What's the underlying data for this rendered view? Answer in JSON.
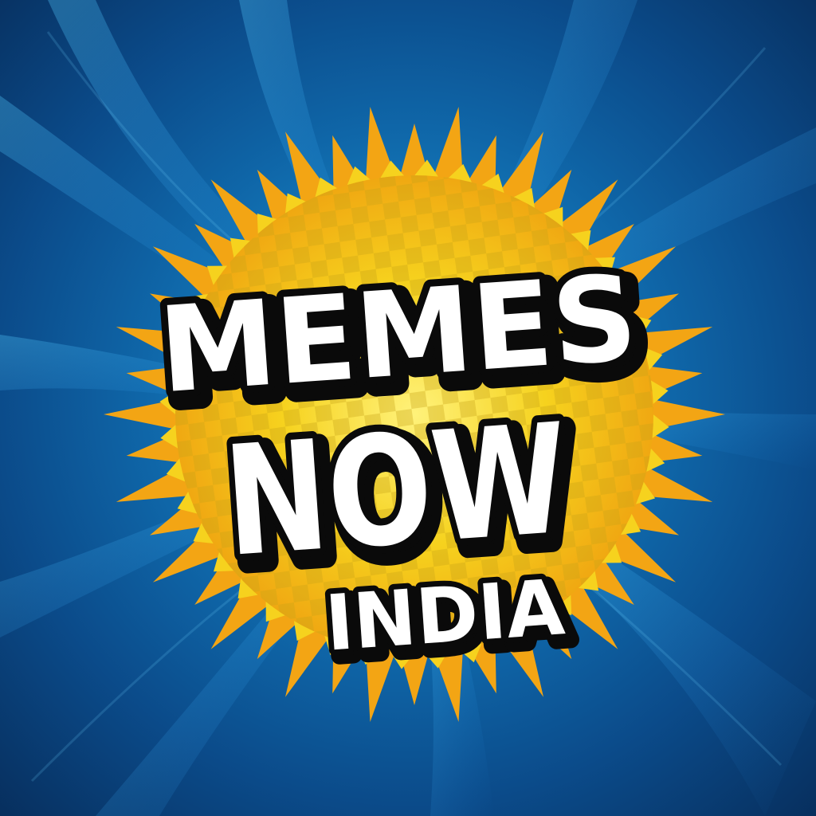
{
  "logo": {
    "line1": "MEMES",
    "line2": "NOW",
    "line3": "INDIA"
  },
  "colors": {
    "background_center": "#1e9fd8",
    "background_edge": "#072f5e",
    "burst_yellow": "#f6d21e",
    "burst_orange": "#f3a514",
    "text_fill": "#ffffff",
    "text_outline": "#0a0a0a"
  }
}
